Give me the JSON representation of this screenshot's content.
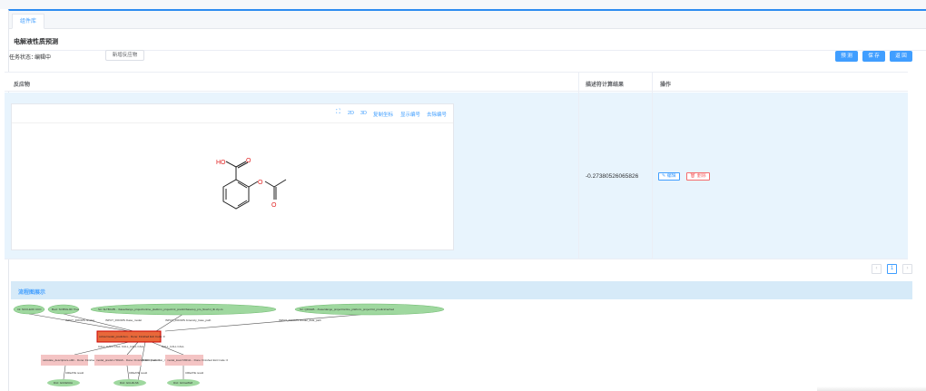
{
  "tab": {
    "label": "组件库"
  },
  "page_title": "电解液性质预测",
  "status": {
    "label": "任务状态：",
    "value": "编辑中"
  },
  "buttons": {
    "add_reactant": "新增反应物",
    "predict": "预 测",
    "save": "保 存",
    "back": "返 回"
  },
  "table": {
    "headers": [
      "反应物",
      "描述符计算结果",
      "操作"
    ],
    "row": {
      "result": "-0.27380526065826",
      "edit": "编辑",
      "delete": "删除"
    }
  },
  "editor": {
    "toolbar": [
      "2D",
      "3D",
      "复制坐标",
      "显示编号",
      "去除编号"
    ],
    "molecule_labels": {
      "ho": "HO",
      "o1": "O",
      "o2": "O",
      "o3": "O"
    }
  },
  "pagination": {
    "prev": "‹",
    "current": "1",
    "next": "›"
  },
  "flow": {
    "title": "流程图展示",
    "nodes": {
      "n1": "Int: SCCLE3O  CCO",
      "n2": "Bool: SCBSG-RF  True",
      "n3": "Str: SLTBCZB...  /base/dango_project/online_platform_project/ml_predict/base/ep_pro_flow/ml_lib.zip.cs",
      "n4": "Str: QDGEB...  /base/dango_project/online_platform_project/ml_predict/cached",
      "main": "cobsu/model_prediction... Done: Finished  Exit Code: 0",
      "c1": "calculate_descriptors-u0R... Done: Finished  Exit Code: 0",
      "c2": "model_predict-YRGMi... Done: Finished  Exit Code: 0",
      "c3": "model_load-TZRGb... Done: Finished  Exit Code: 0",
      "o1": "Dict: GCFE9UA",
      "o2": "Dict: GCLRLS6",
      "o3": "Dict: GCGe8G8"
    },
    "edges": {
      "e1": "INPUT_ROOMS  /smiles",
      "e2": "INPUT_ROOMS  /base_model",
      "e3": "INPUT_ROOMS  /intensity_base_path",
      "e4": "INPUT_ROOMS  /model_data_path",
      "e5": "CALL_CALL  CALL",
      "e6": "CALL_CALL  CALL",
      "e7": "RETURN  /prediction_result",
      "e8": "CALL_CALL  CALL",
      "e9": "CREATE  result",
      "e10": "CREATE  result",
      "e11": "CREATE  result"
    }
  },
  "colors": {
    "primary": "#409eff",
    "danger": "#f56c6c",
    "row_bg": "#e8f4fd",
    "flow_node": "#9fd89f",
    "flow_calc": "#f4c4c4",
    "flow_main": "#e8683a"
  }
}
